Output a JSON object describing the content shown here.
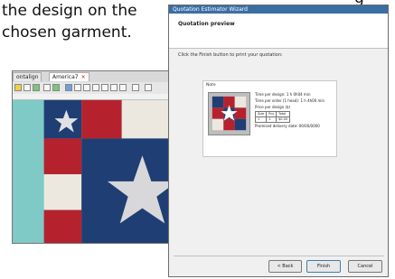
{
  "caption": {
    "line1": "the design on the",
    "line2": "chosen garment.",
    "fragment": "g"
  },
  "editor": {
    "tabs": [
      "ontalign",
      "America7"
    ],
    "close_glyph": "×",
    "colors": {
      "navy": "#1f3e73",
      "red": "#b5222e",
      "white": "#ece8e0",
      "teal": "#7fc9c6",
      "star": "#d8d8da"
    }
  },
  "dialog": {
    "title": "Quotation Estimator Wizard",
    "heading": "Quotation preview",
    "instruction": "Click the Finish button to print your quotation:",
    "preview_label": "Note",
    "info": {
      "time_design": "Time per design: 1 h 0h04 min",
      "time_order": "Time per order (1 head): 1 h 4h00 min",
      "price_label": "Price per design ($)",
      "table_head": [
        "Size",
        "Pcs",
        "Total"
      ],
      "table_row": [
        "1",
        "1",
        "$0.00"
      ],
      "delivery": "Promised delivery date: 00/00/0000"
    },
    "buttons": {
      "back": "< Back",
      "finish": "Finish",
      "cancel": "Cancel"
    }
  }
}
